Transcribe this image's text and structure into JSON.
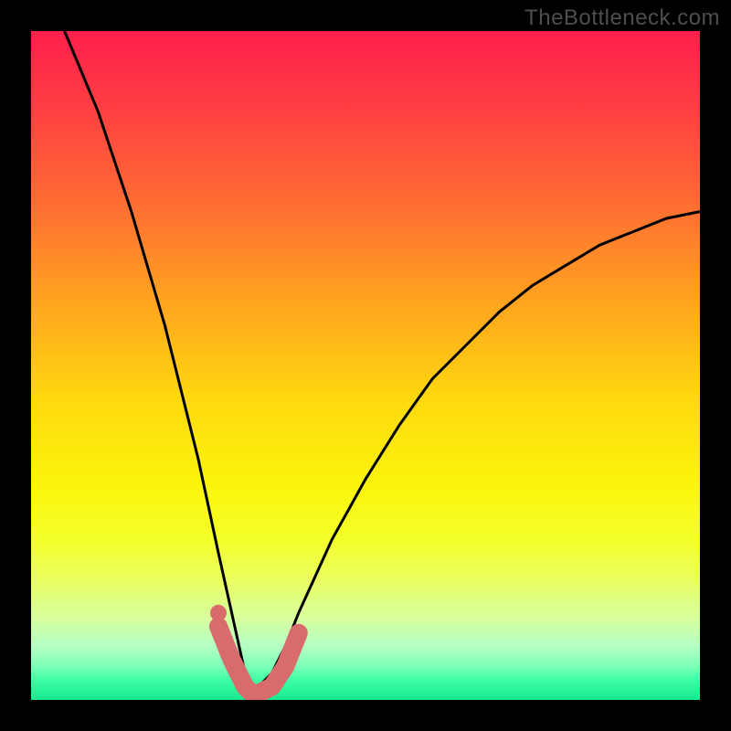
{
  "watermark": "TheBottleneck.com",
  "colors": {
    "frame": "#000000",
    "curve_stroke": "#000000",
    "marker_fill": "#d86b6b",
    "marker_dot": "#d86b6b"
  },
  "chart_data": {
    "type": "line",
    "title": "",
    "xlabel": "",
    "ylabel": "",
    "xlim": [
      0,
      100
    ],
    "ylim": [
      0,
      100
    ],
    "curve": {
      "comment": "V-shaped bottleneck curve; y is approximate % height (100=top red, 0=bottom green). Minimum near x≈33.",
      "x": [
        5,
        10,
        15,
        20,
        25,
        28,
        30,
        32,
        33,
        34,
        36,
        38,
        40,
        45,
        50,
        55,
        60,
        65,
        70,
        75,
        80,
        85,
        90,
        95,
        100
      ],
      "y": [
        100,
        88,
        73,
        56,
        36,
        22,
        13,
        4,
        2,
        2,
        4,
        8,
        13,
        24,
        33,
        41,
        48,
        53,
        58,
        62,
        65,
        68,
        70,
        72,
        73
      ]
    },
    "highlight_segment": {
      "comment": "Thick salmon stroke along the bottom of the V (the sweet-spot band).",
      "x": [
        28,
        30,
        32,
        33,
        34,
        36,
        38,
        40
      ],
      "y": [
        11,
        6,
        2,
        1,
        1,
        2,
        5,
        10
      ]
    },
    "marker_dot": {
      "x": 28,
      "y": 13
    }
  }
}
